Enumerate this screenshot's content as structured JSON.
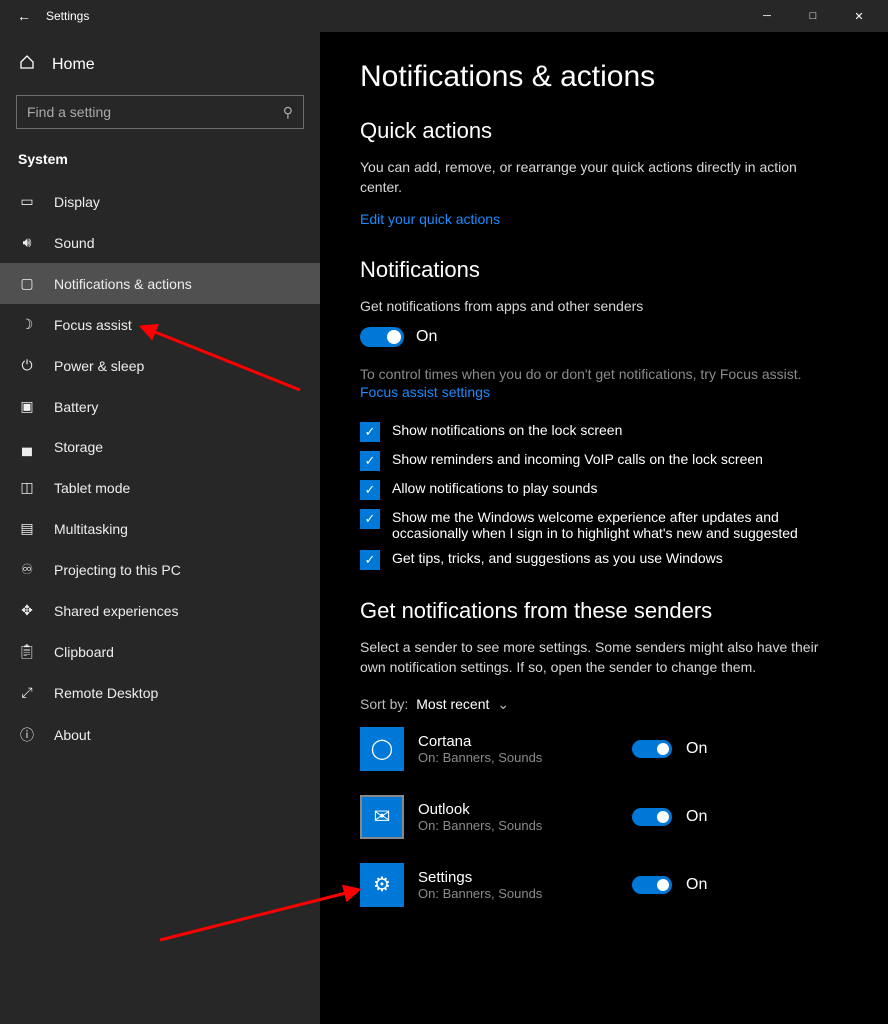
{
  "window": {
    "title": "Settings"
  },
  "sidebar": {
    "home": "Home",
    "search_placeholder": "Find a setting",
    "section": "System",
    "items": [
      {
        "label": "Display"
      },
      {
        "label": "Sound"
      },
      {
        "label": "Notifications & actions"
      },
      {
        "label": "Focus assist"
      },
      {
        "label": "Power & sleep"
      },
      {
        "label": "Battery"
      },
      {
        "label": "Storage"
      },
      {
        "label": "Tablet mode"
      },
      {
        "label": "Multitasking"
      },
      {
        "label": "Projecting to this PC"
      },
      {
        "label": "Shared experiences"
      },
      {
        "label": "Clipboard"
      },
      {
        "label": "Remote Desktop"
      },
      {
        "label": "About"
      }
    ]
  },
  "page": {
    "title": "Notifications & actions",
    "quick": {
      "heading": "Quick actions",
      "desc": "You can add, remove, or rearrange your quick actions directly in action center.",
      "link": "Edit your quick actions"
    },
    "notif": {
      "heading": "Notifications",
      "main_label": "Get notifications from apps and other senders",
      "toggle_state": "On",
      "focus_hint": "To control times when you do or don't get notifications, try Focus assist.",
      "focus_link": "Focus assist settings",
      "checks": [
        "Show notifications on the lock screen",
        "Show reminders and incoming VoIP calls on the lock screen",
        "Allow notifications to play sounds",
        "Show me the Windows welcome experience after updates and occasionally when I sign in to highlight what's new and suggested",
        "Get tips, tricks, and suggestions as you use Windows"
      ]
    },
    "senders": {
      "heading": "Get notifications from these senders",
      "desc": "Select a sender to see more settings. Some senders might also have their own notification settings. If so, open the sender to change them.",
      "sort_label": "Sort by:",
      "sort_value": "Most recent",
      "on": "On",
      "list": [
        {
          "name": "Cortana",
          "sub": "On: Banners, Sounds"
        },
        {
          "name": "Outlook",
          "sub": "On: Banners, Sounds"
        },
        {
          "name": "Settings",
          "sub": "On: Banners, Sounds"
        }
      ]
    }
  }
}
